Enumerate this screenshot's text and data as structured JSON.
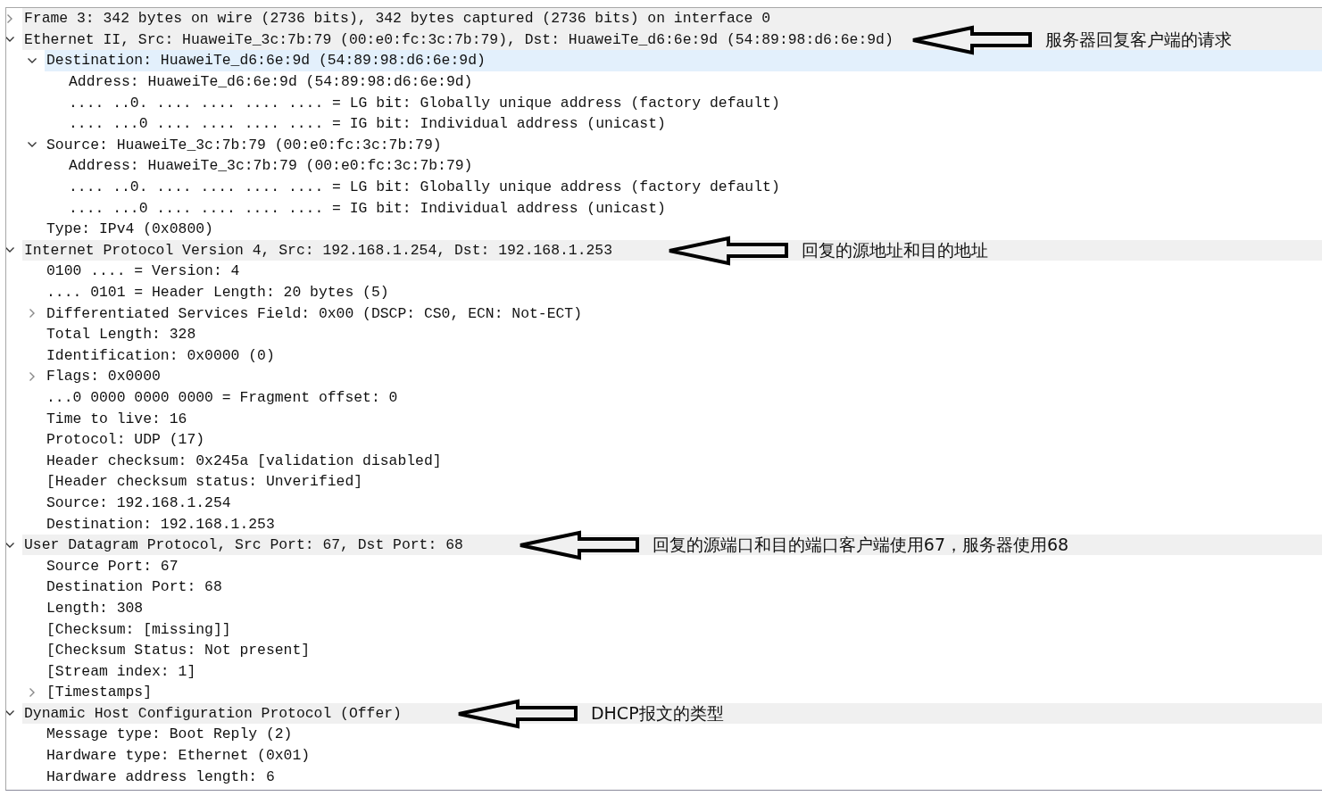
{
  "packet_details": [
    {
      "label": "Frame 3: 342 bytes on wire (2736 bits), 342 bytes captured (2736 bits) on interface 0",
      "expanded": false,
      "selected": false
    },
    {
      "label": "Ethernet II, Src: HuaweiTe_3c:7b:79 (00:e0:fc:3c:7b:79), Dst: HuaweiTe_d6:6e:9d (54:89:98:d6:6e:9d)",
      "expanded": true,
      "selected": false,
      "annotation": "服务器回复客户端的请求",
      "children": [
        {
          "label": "Destination: HuaweiTe_d6:6e:9d (54:89:98:d6:6e:9d)",
          "expanded": true,
          "selected": true,
          "children": [
            {
              "label": "Address: HuaweiTe_d6:6e:9d (54:89:98:d6:6e:9d)",
              "selected": false
            },
            {
              "label": ".... ..0. .... .... .... .... = LG bit: Globally unique address (factory default)",
              "selected": false
            },
            {
              "label": ".... ...0 .... .... .... .... = IG bit: Individual address (unicast)",
              "selected": false
            }
          ]
        },
        {
          "label": "Source: HuaweiTe_3c:7b:79 (00:e0:fc:3c:7b:79)",
          "expanded": true,
          "selected": false,
          "children": [
            {
              "label": "Address: HuaweiTe_3c:7b:79 (00:e0:fc:3c:7b:79)",
              "selected": false
            },
            {
              "label": ".... ..0. .... .... .... .... = LG bit: Globally unique address (factory default)",
              "selected": false
            },
            {
              "label": ".... ...0 .... .... .... .... = IG bit: Individual address (unicast)",
              "selected": false
            }
          ]
        },
        {
          "label": "Type: IPv4 (0x0800)",
          "selected": false
        }
      ]
    },
    {
      "label": "Internet Protocol Version 4, Src: 192.168.1.254, Dst: 192.168.1.253",
      "expanded": true,
      "selected": false,
      "annotation": "回复的源地址和目的地址",
      "children": [
        {
          "label": "0100 .... = Version: 4",
          "selected": false
        },
        {
          "label": ".... 0101 = Header Length: 20 bytes (5)",
          "selected": false
        },
        {
          "label": "Differentiated Services Field: 0x00 (DSCP: CS0, ECN: Not-ECT)",
          "expanded": false,
          "selected": false
        },
        {
          "label": "Total Length: 328",
          "selected": false
        },
        {
          "label": "Identification: 0x0000 (0)",
          "selected": false
        },
        {
          "label": "Flags: 0x0000",
          "expanded": false,
          "selected": false
        },
        {
          "label": "...0 0000 0000 0000 = Fragment offset: 0",
          "selected": false
        },
        {
          "label": "Time to live: 16",
          "selected": false
        },
        {
          "label": "Protocol: UDP (17)",
          "selected": false
        },
        {
          "label": "Header checksum: 0x245a [validation disabled]",
          "selected": false
        },
        {
          "label": "[Header checksum status: Unverified]",
          "selected": false
        },
        {
          "label": "Source: 192.168.1.254",
          "selected": false
        },
        {
          "label": "Destination: 192.168.1.253",
          "selected": false
        }
      ]
    },
    {
      "label": "User Datagram Protocol, Src Port: 67, Dst Port: 68",
      "expanded": true,
      "selected": false,
      "annotation": "回复的源端口和目的端口客户端使用67，服务器使用68",
      "children": [
        {
          "label": "Source Port: 67",
          "selected": false
        },
        {
          "label": "Destination Port: 68",
          "selected": false
        },
        {
          "label": "Length: 308",
          "selected": false
        },
        {
          "label": "[Checksum: [missing]]",
          "selected": false
        },
        {
          "label": "[Checksum Status: Not present]",
          "selected": false
        },
        {
          "label": "[Stream index: 1]",
          "selected": false
        },
        {
          "label": "[Timestamps]",
          "expanded": false,
          "selected": false
        }
      ]
    },
    {
      "label": "Dynamic Host Configuration Protocol (Offer)",
      "expanded": true,
      "selected": false,
      "annotation": "DHCP报文的类型",
      "children": [
        {
          "label": "Message type: Boot Reply (2)",
          "selected": false
        },
        {
          "label": "Hardware type: Ethernet (0x01)",
          "selected": false
        },
        {
          "label": "Hardware address length: 6",
          "selected": false
        }
      ]
    }
  ]
}
